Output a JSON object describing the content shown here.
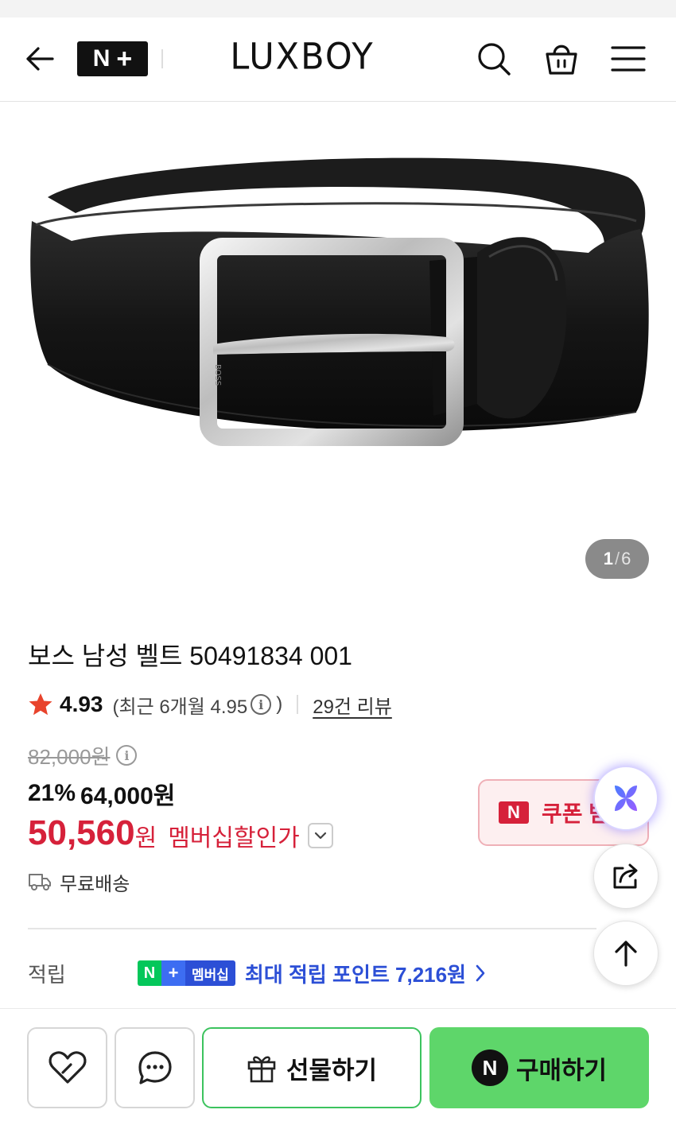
{
  "header": {
    "brand": "LUXBOY",
    "nplus_n": "N",
    "nplus_plus": "+"
  },
  "gallery": {
    "current_page": "1",
    "separator": "/",
    "total_pages": "6",
    "belt_engraving": "BOSS"
  },
  "product": {
    "title": "보스 남성 벨트 50491834 001",
    "rating": "4.93",
    "recent_rating_open": "(최근 6개월 4.95",
    "recent_rating_close": ")",
    "review_link": "29건 리뷰",
    "original_price": "82,000원",
    "discount_pct": "21%",
    "sale_price": "64,000원",
    "member_price_num": "50,560",
    "member_price_unit": "원",
    "member_price_label": "멤버십할인가",
    "coupon_label": "쿠폰 받",
    "coupon_n": "N",
    "shipping": "무료배송",
    "points_label": "적립",
    "nplus_n": "N",
    "nplus_plus": "+",
    "membership_badge": "멤버십",
    "points_text": "최대 적립 포인트 7,216원"
  },
  "actions": {
    "gift_label": "선물하기",
    "buy_n": "N",
    "buy_label": "구매하기"
  },
  "colors": {
    "sale_red": "#d6213a",
    "naver_green": "#5ed66a",
    "membership_blue": "#2c4fd6"
  },
  "icons": [
    "back-arrow-icon",
    "search-icon",
    "shopping-bag-icon",
    "hamburger-menu-icon",
    "star-icon",
    "info-icon",
    "chevron-down-icon",
    "truck-icon",
    "chevron-right-icon",
    "ai-assistant-icon",
    "share-icon",
    "arrow-up-icon",
    "heart-icon",
    "chat-icon",
    "gift-icon"
  ]
}
